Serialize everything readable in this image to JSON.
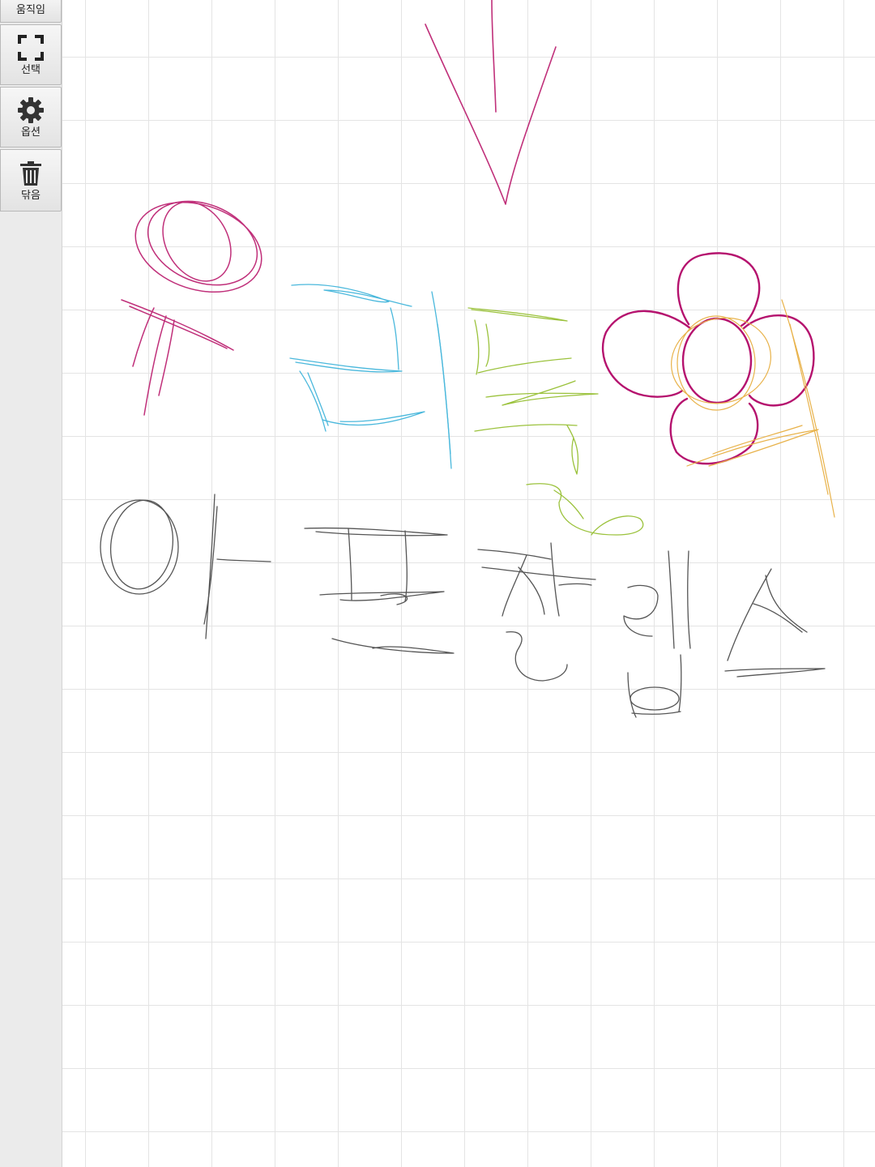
{
  "toolbar": {
    "move_label": "움직임",
    "select_label": "선택",
    "options_label": "옵션",
    "close_label": "닦음"
  },
  "icons": {
    "select": "select-frame-icon",
    "options": "gear-icon",
    "close": "trash-icon"
  },
  "colors": {
    "grid": "#e4e4e4",
    "sidebar": "#ebebeb",
    "ink_magenta": "#c0307a",
    "ink_cyan": "#4ab8dc",
    "ink_green": "#9bc23c",
    "ink_flower": "#b5126e",
    "ink_orange": "#e8b24a",
    "ink_gray": "#555555"
  }
}
